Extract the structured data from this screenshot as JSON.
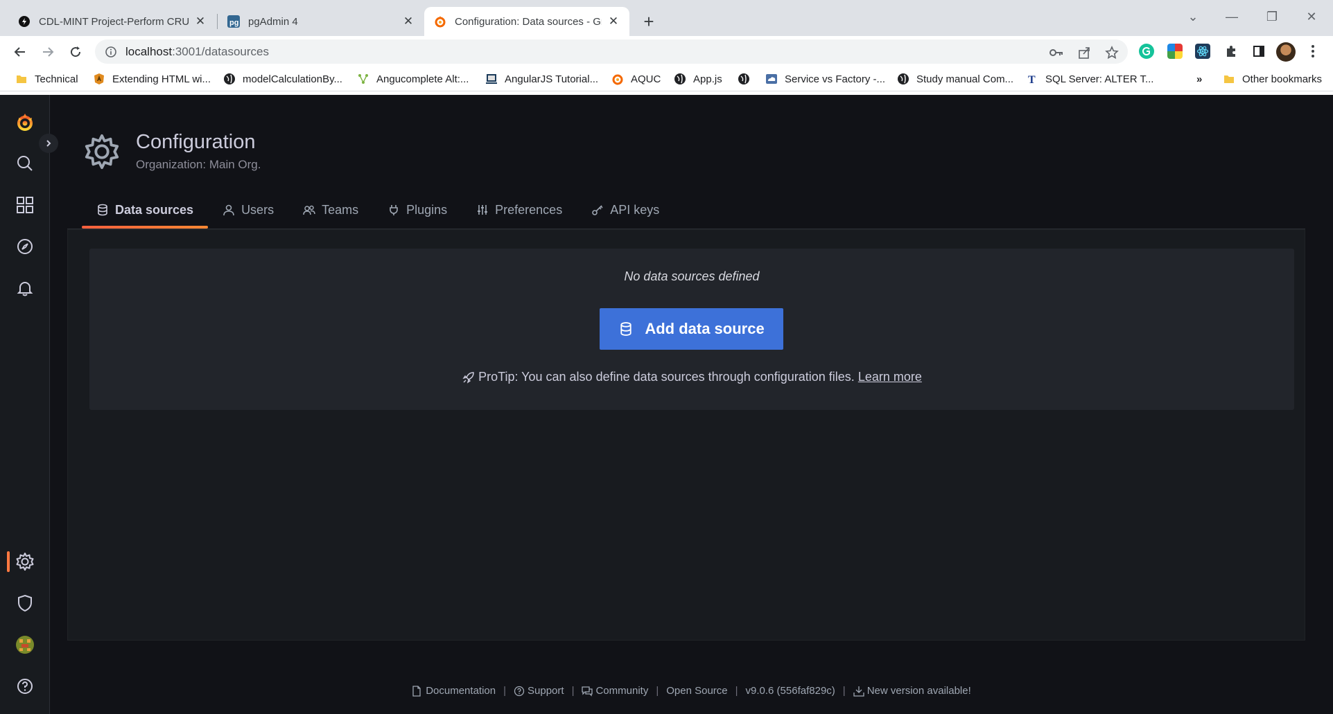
{
  "browser": {
    "tabs": [
      {
        "title": "CDL-MINT Project-Perform CRUD",
        "icon": "ant-icon"
      },
      {
        "title": "pgAdmin 4",
        "icon": "pgadmin-icon"
      },
      {
        "title": "Configuration: Data sources - Gra",
        "icon": "grafana-icon"
      }
    ],
    "url_host": "localhost",
    "url_rest": ":3001/datasources",
    "bookmarks": [
      {
        "label": "Technical",
        "icon": "folder-icon"
      },
      {
        "label": "Extending HTML wi...",
        "icon": "angular-shield-icon"
      },
      {
        "label": "modelCalculationBy...",
        "icon": "globe-icon"
      },
      {
        "label": "Angucomplete Alt:...",
        "icon": "tree-icon"
      },
      {
        "label": "AngularJS Tutorial...",
        "icon": "laptop-icon"
      },
      {
        "label": "AQUC",
        "icon": "grafana-icon"
      },
      {
        "label": "App.js",
        "icon": "globe-icon"
      },
      {
        "label": "",
        "icon": "globe-icon"
      },
      {
        "label": "Service vs Factory -...",
        "icon": "cloud-icon"
      },
      {
        "label": "Study manual Com...",
        "icon": "globe-icon"
      },
      {
        "label": "SQL Server: ALTER T...",
        "icon": "t-icon"
      }
    ],
    "more_bookmarks": "»",
    "other_bookmarks": "Other bookmarks"
  },
  "page": {
    "title": "Configuration",
    "subtitle": "Organization: Main Org.",
    "tabs": [
      {
        "label": "Data sources",
        "icon": "database-icon",
        "active": true
      },
      {
        "label": "Users",
        "icon": "user-icon"
      },
      {
        "label": "Teams",
        "icon": "users-icon"
      },
      {
        "label": "Plugins",
        "icon": "plug-icon"
      },
      {
        "label": "Preferences",
        "icon": "sliders-icon"
      },
      {
        "label": "API keys",
        "icon": "key-icon"
      }
    ]
  },
  "empty_state": {
    "title": "No data sources defined",
    "button_label": "Add data source",
    "protip": "ProTip: You can also define data sources through configuration files.",
    "learn_more": "Learn more"
  },
  "footer": {
    "documentation": "Documentation",
    "support": "Support",
    "community": "Community",
    "open_source": "Open Source",
    "version": "v9.0.6 (556faf829c)",
    "new_version": "New version available!"
  },
  "colors": {
    "accent": "#ff7941",
    "primary_button": "#3d71d9",
    "background": "#111217"
  }
}
